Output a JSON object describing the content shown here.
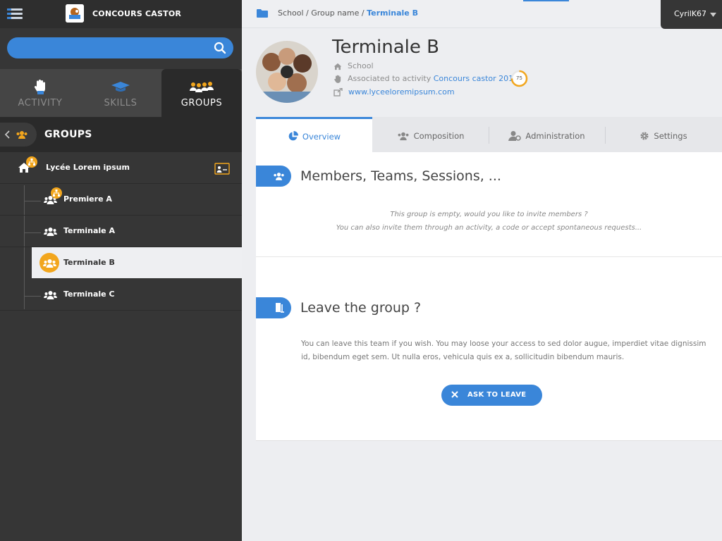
{
  "app": {
    "name": "CONCOURS CASTOR"
  },
  "search": {
    "placeholder": ""
  },
  "sidebar": {
    "tabs": [
      {
        "label": "ACTIVITY",
        "icon": "hand-icon"
      },
      {
        "label": "SKILLS",
        "icon": "graduation-cap-icon"
      },
      {
        "label": "GROUPS",
        "icon": "people-group-icon"
      }
    ],
    "section_title": "GROUPS",
    "tree": [
      {
        "label": "Lycée Lorem ipsum",
        "icon": "home-icon"
      },
      {
        "label": "Premiere A",
        "icon": "users-icon"
      },
      {
        "label": "Terminale A",
        "icon": "users-icon"
      },
      {
        "label": "Terminale B",
        "icon": "users-icon"
      },
      {
        "label": "Terminale C",
        "icon": "users-icon"
      }
    ]
  },
  "breadcrumb": {
    "path": "School / Group name /",
    "current": "Terminale B"
  },
  "user": {
    "name": "CyrilK67"
  },
  "group": {
    "title": "Terminale B",
    "type": "School",
    "activity_prefix": "Associated to activity",
    "activity_name": "Concours castor 2018",
    "score": "75",
    "website": "www.lyceeloremipsum.com"
  },
  "tabs": [
    {
      "label": "Overview",
      "icon": "pie-chart-icon"
    },
    {
      "label": "Composition",
      "icon": "users-icon"
    },
    {
      "label": "Administration",
      "icon": "user-cog-icon"
    },
    {
      "label": "Settings",
      "icon": "gear-icon"
    }
  ],
  "members": {
    "title": "Members, Teams, Sessions, ...",
    "empty_line1": "This group is empty, would you like to invite members ?",
    "empty_line2": "You can also invite them through an activity, a code or accept spontaneous requests..."
  },
  "leave": {
    "title": "Leave the group ?",
    "text": "You can leave this team if you wish. You may loose your access to sed dolor augue, imperdiet vitae dignissim id, bibendum eget sem. Ut nulla eros, vehicula quis ex a, sollicitudin bibendum mauris.",
    "button": "ASK TO LEAVE"
  },
  "colors": {
    "accent": "#3a86d9",
    "sidebar": "#363636",
    "badge": "#f2a61d"
  }
}
